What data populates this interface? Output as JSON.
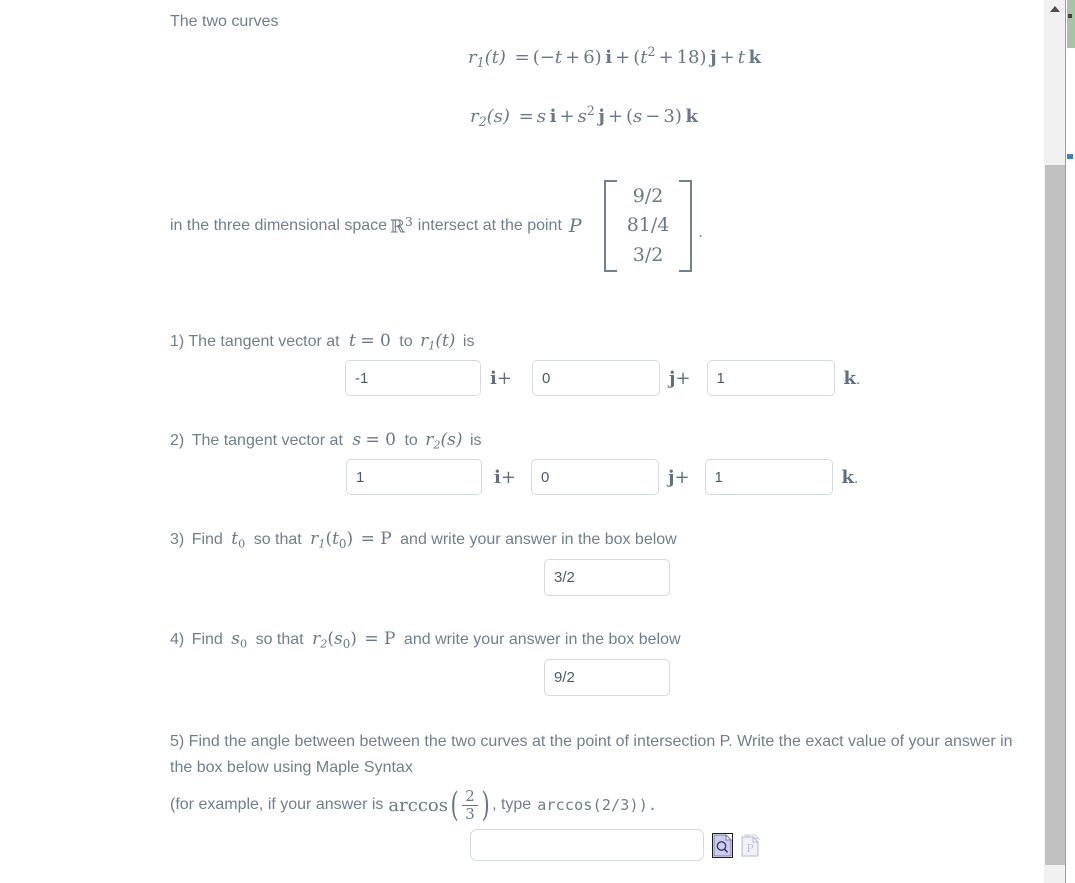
{
  "intro": {
    "lead": "The two curves",
    "equation1": {
      "lhs": "r",
      "lhs_sub": "1",
      "arg": "(t)",
      "rhs": "= (−t + 6) i + (t² + 18) j + t k"
    },
    "equation2": {
      "lhs": "r",
      "lhs_sub": "2",
      "arg": "(s)",
      "rhs": "= s i + s² j + (s − 3) k"
    },
    "intersect_pre": "in the three dimensional space",
    "space_symbol": "R",
    "space_exponent": "3",
    "intersect_mid": "intersect at the point",
    "point_label": "P",
    "point_matrix": [
      "9/2",
      "81/4",
      "3/2"
    ],
    "trailing_period": "."
  },
  "questions": {
    "q1": {
      "number": "1)",
      "text_a": "The tangent vector  at",
      "var": "t",
      "equals": "= 0",
      "text_b": "to",
      "func": "r",
      "func_sub": "1",
      "func_arg": "(t)",
      "text_c": "is",
      "fields": [
        {
          "name": "i-component",
          "value": "-1",
          "unit": "i",
          "unit_op": "+"
        },
        {
          "name": "j-component",
          "value": "0",
          "unit": "j",
          "unit_op": "+"
        },
        {
          "name": "k-component",
          "value": "1",
          "unit": "k",
          "unit_op": "."
        }
      ]
    },
    "q2": {
      "number": "2)",
      "text_a": "The tangent vector  at",
      "var": "s",
      "equals": "= 0",
      "text_b": "to",
      "func": "r",
      "func_sub": "2",
      "func_arg": "(s)",
      "text_c": "is",
      "fields": [
        {
          "name": "i-component",
          "value": "1",
          "unit": "i",
          "unit_op": "+"
        },
        {
          "name": "j-component",
          "value": "0",
          "unit": "j",
          "unit_op": "+"
        },
        {
          "name": "k-component",
          "value": "1",
          "unit": "k",
          "unit_op": "."
        }
      ]
    },
    "q3": {
      "number": "3)",
      "text_a": "Find",
      "var": "t",
      "var_sub": "0",
      "text_b": "so that",
      "func": "r",
      "func_sub": "1",
      "func_arg": "(t₀)",
      "eq_p": "= P",
      "text_c": "and write your answer in the box below",
      "answer": "3/2"
    },
    "q4": {
      "number": "4)",
      "text_a": "Find",
      "var": "s",
      "var_sub": "0",
      "text_b": "so that",
      "func": "r",
      "func_sub": "2",
      "func_arg": "(s₀)",
      "eq_p": "= P",
      "text_c": "and write your answer in the box below",
      "answer": "9/2"
    },
    "q5": {
      "number": "5)",
      "text": "5) Find the angle between between the two curves at the point of intersection P. Write the exact value of your answer in the box below using Maple Syntax",
      "example_pre": "(for example, if your answer is",
      "example_fn": "arccos",
      "example_num": "2",
      "example_den": "3",
      "example_mid": ", type",
      "example_code": "arccos(2/3)).",
      "answer": "",
      "answer_placeholder": ""
    }
  },
  "tools": {
    "preview_icon": "document-magnifier-icon",
    "preview_label": "Preview",
    "maple_icon": "maple-document-icon",
    "maple_label": "Maple"
  },
  "scrollbars": {
    "inner_up_arrow": "scroll-up-arrow",
    "outer_thumb_color": "#a8c4a8",
    "inner_thumb_color": "#c1c1c1"
  }
}
